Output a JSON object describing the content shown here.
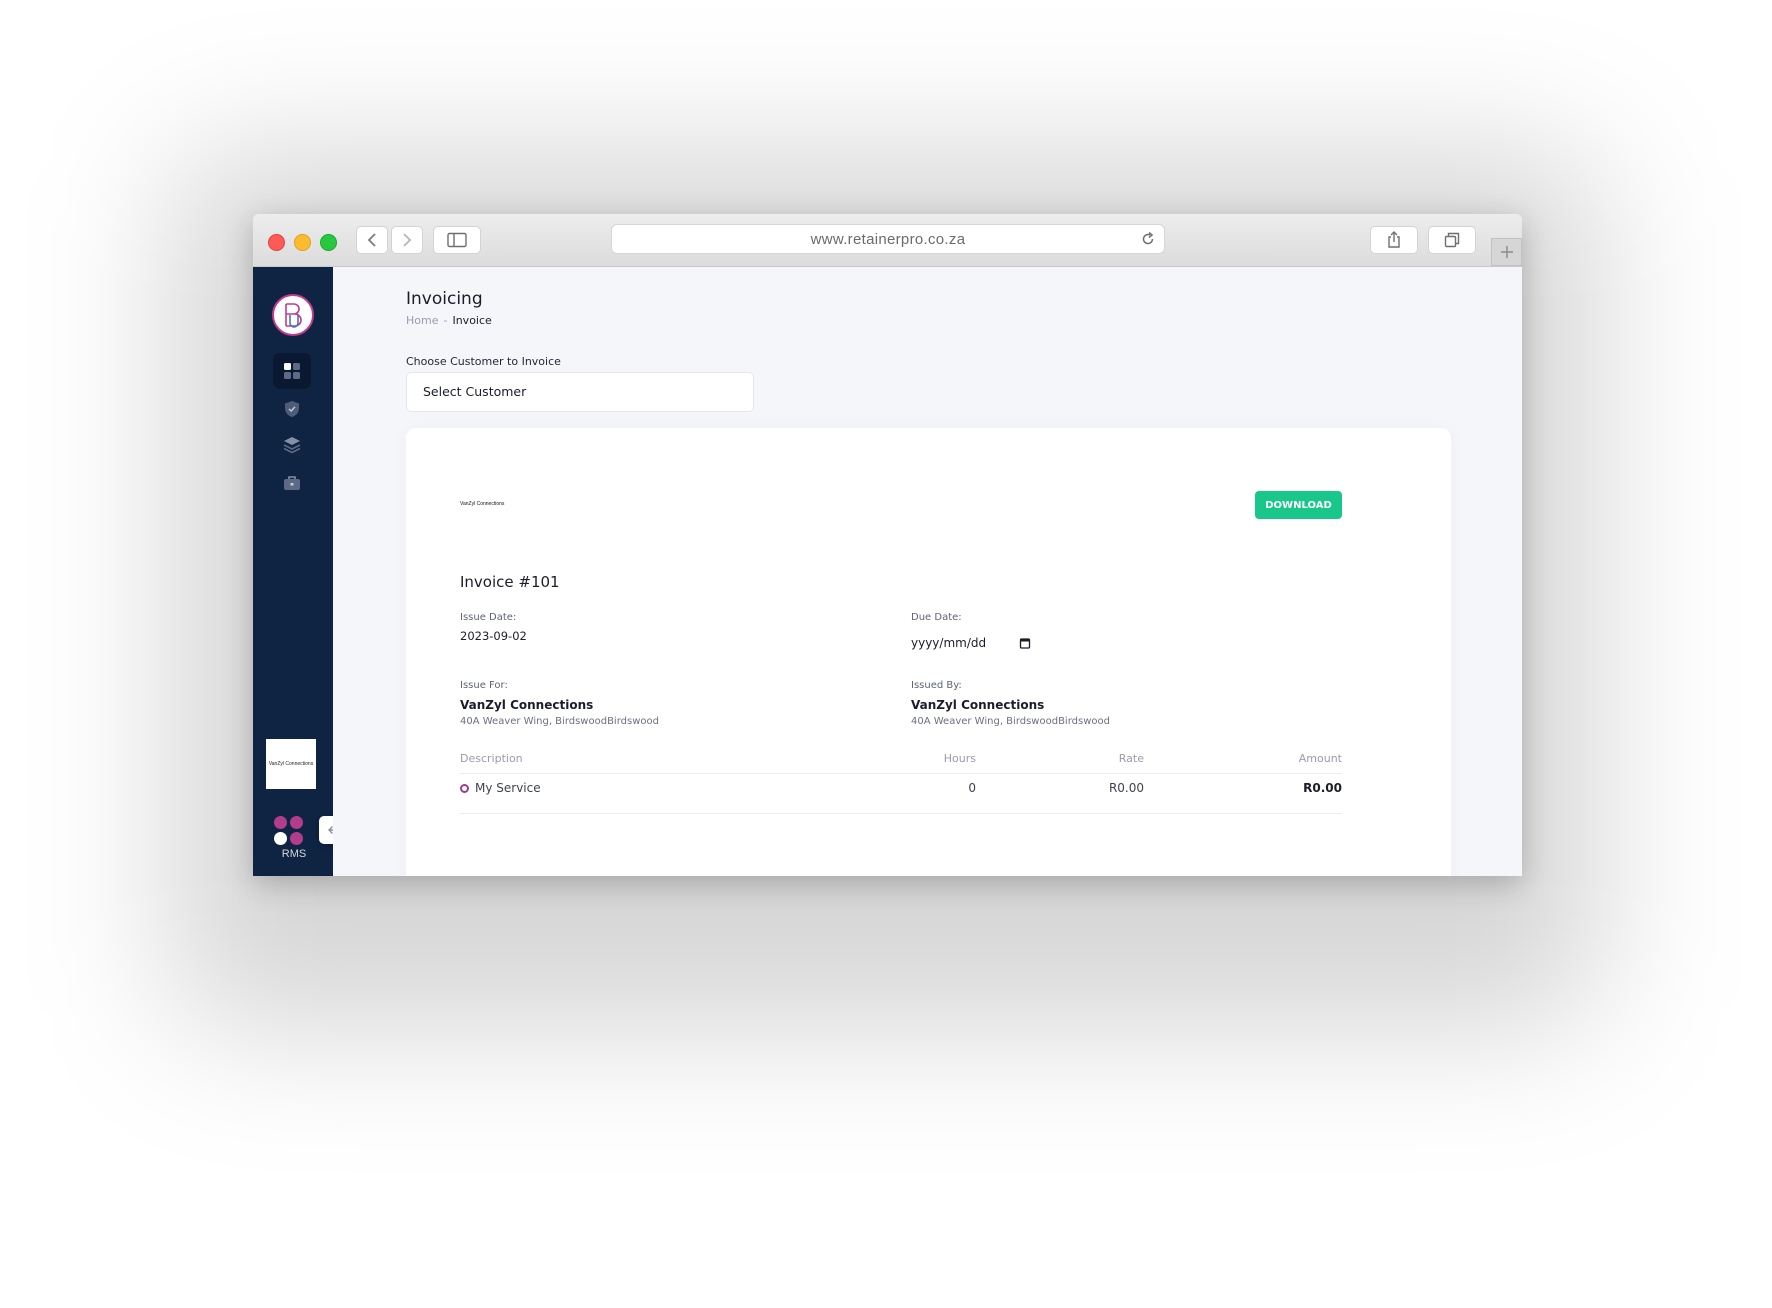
{
  "browser": {
    "url": "www.retainerpro.co.za"
  },
  "sidebar": {
    "brand_logo_letter": "B",
    "nav_items": [
      {
        "icon": "dashboard-grid-icon",
        "active": true
      },
      {
        "icon": "shield-check-icon",
        "active": false
      },
      {
        "icon": "layers-icon",
        "active": false
      },
      {
        "icon": "briefcase-icon",
        "active": false
      }
    ],
    "org_logo_text": "VanZyl Connections",
    "footer_logo_text": "RMS",
    "footer_dot_colors": [
      "#b23c8d",
      "#b23c8d",
      "#ffffff",
      "#b23c8d"
    ]
  },
  "page": {
    "title": "Invoicing",
    "breadcrumb": {
      "home": "Home",
      "separator": "-",
      "current": "Invoice"
    }
  },
  "customer_select": {
    "label": "Choose Customer to Invoice",
    "value": "Select Customer"
  },
  "invoice": {
    "logo_text": "VanZyl Connections",
    "download_label": "DOWNLOAD",
    "title": "Invoice #101",
    "issue_date_label": "Issue Date:",
    "issue_date": "2023-09-02",
    "due_date_label": "Due Date:",
    "due_date_placeholder": "yyyy/mm/dd",
    "issue_for_label": "Issue For:",
    "issue_for_name": "VanZyl Connections",
    "issue_for_address": "40A Weaver Wing, BirdswoodBirdswood",
    "issued_by_label": "Issued By:",
    "issued_by_name": "VanZyl Connections",
    "issued_by_address": "40A Weaver Wing, BirdswoodBirdswood",
    "table": {
      "headers": {
        "description": "Description",
        "hours": "Hours",
        "rate": "Rate",
        "amount": "Amount"
      },
      "rows": [
        {
          "description": "My Service",
          "hours": "0",
          "rate": "R0.00",
          "amount": "R0.00"
        }
      ]
    }
  },
  "colors": {
    "sidebar_bg": "#0f2342",
    "accent_green": "#19c78a",
    "brand_magenta": "#b23c8d",
    "content_bg": "#f4f6f9"
  }
}
